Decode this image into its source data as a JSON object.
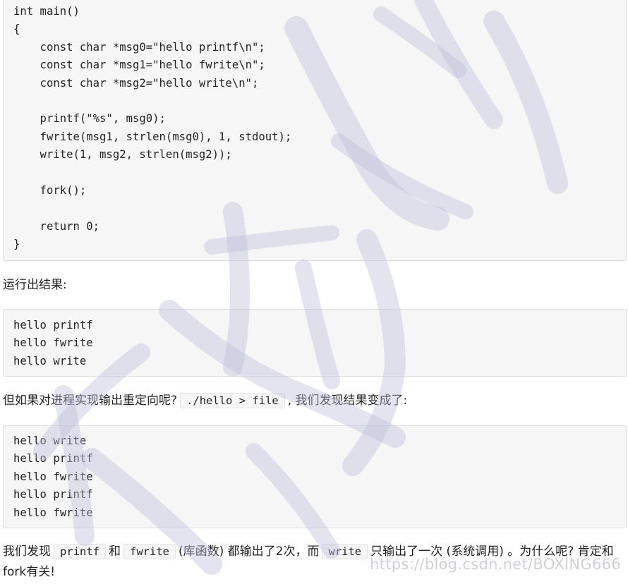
{
  "code_main": [
    "int main()",
    "{",
    "    const char *msg0=\"hello printf\\n\";",
    "    const char *msg1=\"hello fwrite\\n\";",
    "    const char *msg2=\"hello write\\n\";",
    "",
    "    printf(\"%s\", msg0);",
    "    fwrite(msg1, strlen(msg0), 1, stdout);",
    "    write(1, msg2, strlen(msg2));",
    "",
    "    fork();",
    "",
    "    return 0;",
    "}"
  ],
  "para_result": "运行出结果:",
  "output_1": [
    "hello printf",
    "hello fwrite",
    "hello write"
  ],
  "para_redirect": {
    "before": "但如果对进程实现输出重定向呢?",
    "code": "./hello > file",
    "after": ", 我们发现结果变成了:"
  },
  "output_2": [
    "hello write",
    "hello printf",
    "hello fwrite",
    "hello printf",
    "hello fwrite"
  ],
  "para_final": {
    "t1": "我们发现",
    "c1": "printf",
    "t2": "和",
    "c2": "fwrite",
    "t3": "(库函数) 都输出了2次，而",
    "c3": "write",
    "t4": "只输出了一次 (系统调用) 。为什么呢? 肯定和fork有关!"
  },
  "watermark_url": "https://blog.csdn.net/BOXING666",
  "colors": {
    "code_background": "#f6f6f6",
    "watermark": "#d6d6e6"
  }
}
